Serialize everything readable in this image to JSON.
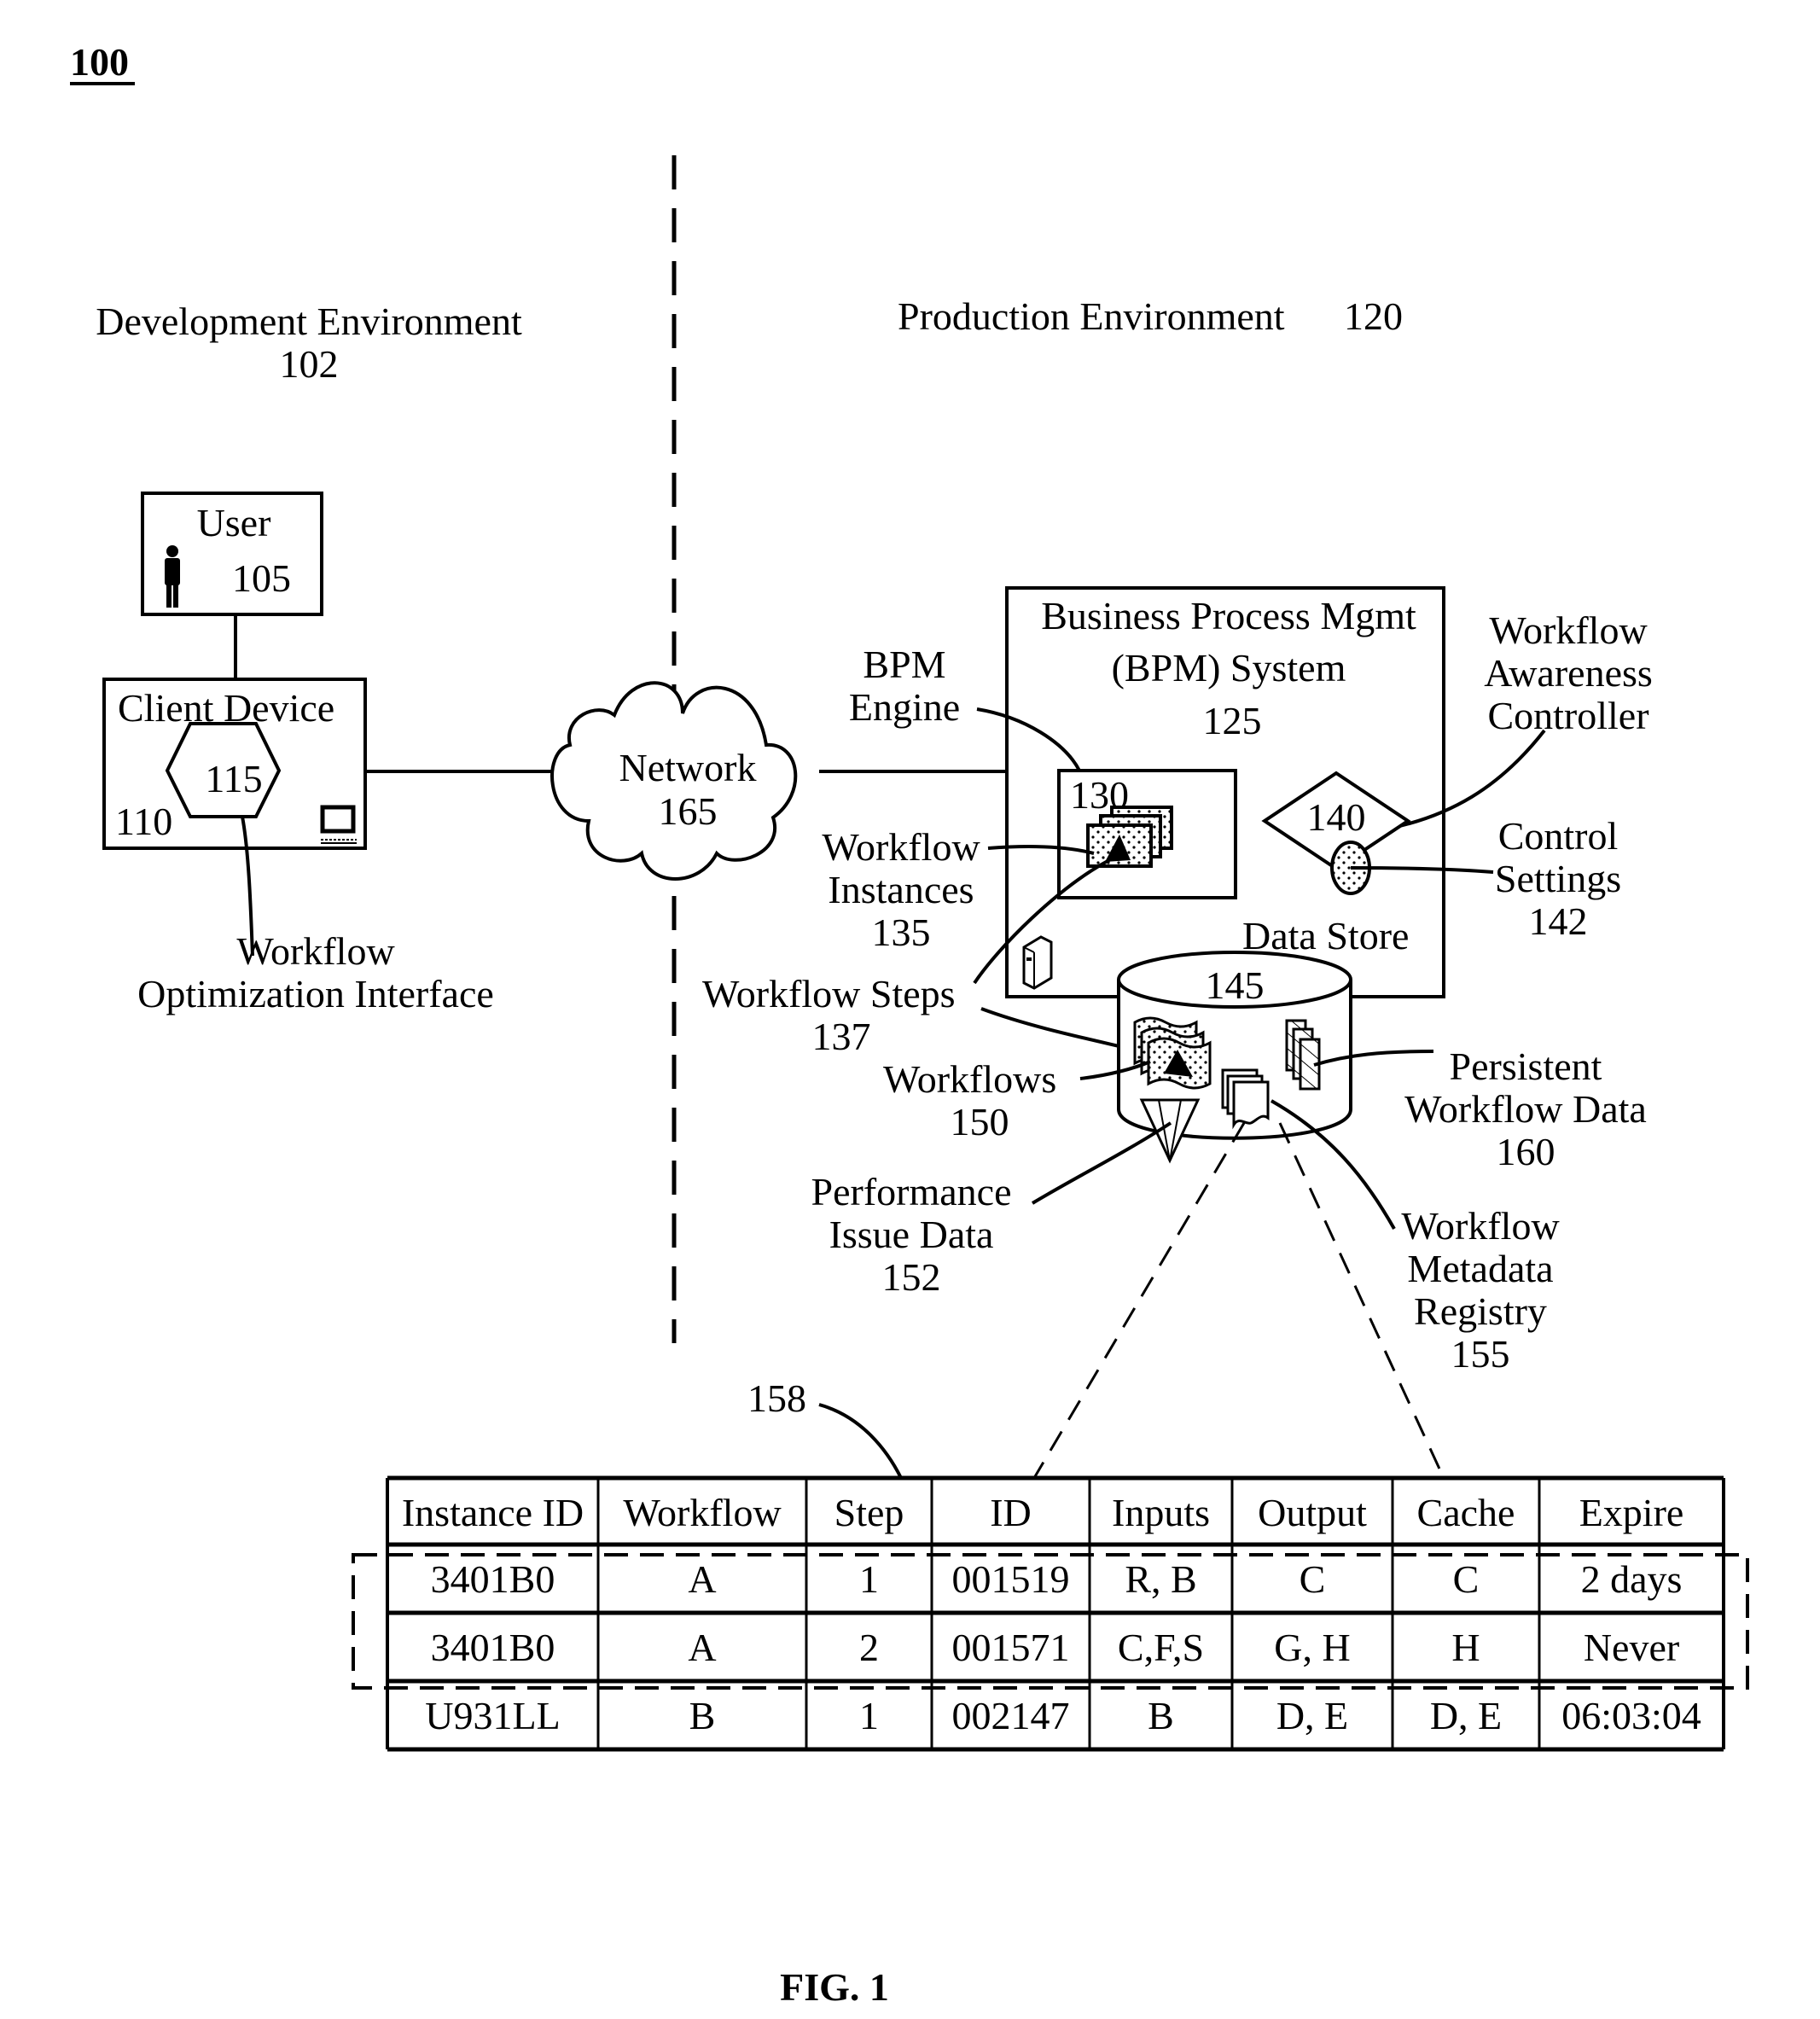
{
  "figure": {
    "ref": "100",
    "caption": "FIG. 1"
  },
  "environments": {
    "development": {
      "label": "Development Environment",
      "ref": "102"
    },
    "production": {
      "label": "Production Environment",
      "ref": "120"
    }
  },
  "nodes": {
    "user": {
      "label": "User",
      "ref": "105",
      "icon": "person-icon"
    },
    "client_device": {
      "label": "Client Device",
      "ref": "110",
      "icon": "computer-icon"
    },
    "workflow_optimization_interface": {
      "ref": "115",
      "label_line1": "Workflow",
      "label_line2": "Optimization Interface"
    },
    "network": {
      "label": "Network",
      "ref": "165"
    },
    "bpm_system": {
      "label_line1": "Business Process Mgmt",
      "label_line2": "(BPM) System",
      "ref": "125",
      "icon": "server-icon"
    },
    "bpm_engine": {
      "label_line1": "BPM",
      "label_line2": "Engine",
      "ref": "130"
    },
    "workflow_instances": {
      "label_line1": "Workflow",
      "label_line2": "Instances",
      "ref": "135"
    },
    "workflow_steps": {
      "label": "Workflow Steps",
      "ref": "137"
    },
    "workflow_awareness_controller": {
      "label_line1": "Workflow",
      "label_line2": "Awareness",
      "label_line3": "Controller",
      "ref": "140"
    },
    "control_settings": {
      "label_line1": "Control",
      "label_line2": "Settings",
      "ref": "142"
    },
    "data_store": {
      "label": "Data Store",
      "ref": "145"
    },
    "workflows": {
      "label": "Workflows",
      "ref": "150"
    },
    "performance_issue_data": {
      "label_line1": "Performance",
      "label_line2": "Issue Data",
      "ref": "152"
    },
    "workflow_metadata_registry": {
      "label_line1": "Workflow",
      "label_line2": "Metadata",
      "label_line3": "Registry",
      "ref": "155"
    },
    "persistent_workflow_data": {
      "label_line1": "Persistent",
      "label_line2": "Workflow Data",
      "ref": "160"
    }
  },
  "table": {
    "ref": "158",
    "columns": [
      "Instance ID",
      "Workflow",
      "Step",
      "ID",
      "Inputs",
      "Output",
      "Cache",
      "Expire"
    ],
    "rows": [
      [
        "3401B0",
        "A",
        "1",
        "001519",
        "R, B",
        "C",
        "C",
        "2 days"
      ],
      [
        "3401B0",
        "A",
        "2",
        "001571",
        "C,F,S",
        "G, H",
        "H",
        "Never"
      ],
      [
        "U931LL",
        "B",
        "1",
        "002147",
        "B",
        "D, E",
        "D, E",
        "06:03:04"
      ]
    ],
    "highlighted_rows": [
      0,
      1
    ]
  }
}
